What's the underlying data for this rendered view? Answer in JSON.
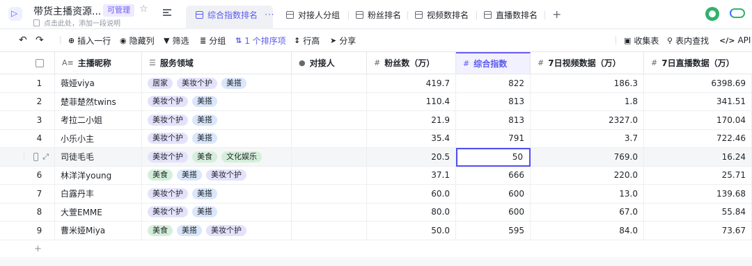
{
  "header": {
    "title": "带货主播资源...",
    "permission_badge": "可管理",
    "subtitle": "点击此处，添加一段说明",
    "tabs": [
      {
        "label": "综合指数排名",
        "more": "···"
      },
      {
        "label": "对接人分组"
      },
      {
        "label": "粉丝排名"
      },
      {
        "label": "视频数排名"
      },
      {
        "label": "直播数排名"
      }
    ],
    "add_tab": "+",
    "icons": {
      "logo": "base-logo-icon",
      "star": "star-icon",
      "menu": "menu-icon",
      "avatar": "avatar",
      "sync": "cloud-sync-icon"
    }
  },
  "toolbar": {
    "undo": "↶",
    "redo": "↷",
    "insert_row": "插入一行",
    "hide_columns": "隐藏列",
    "filter": "筛选",
    "group": "分组",
    "sort": "1 个排序项",
    "row_height": "行高",
    "share": "分享",
    "form": "收集表",
    "search": "表内查找",
    "api": "API",
    "accent_color": "#5b5bf0"
  },
  "table": {
    "columns": [
      {
        "label": "主播昵称",
        "icon": "text-field-icon"
      },
      {
        "label": "服务领域",
        "icon": "multi-select-icon"
      },
      {
        "label": "对接人",
        "icon": "person-icon"
      },
      {
        "label": "粉丝数（万）",
        "icon": "number-icon"
      },
      {
        "label": "综合指数",
        "icon": "number-icon"
      },
      {
        "label": "7日视频数据（万）",
        "icon": "number-icon"
      },
      {
        "label": "7日直播数据（万）",
        "icon": "number-icon"
      }
    ],
    "rows": [
      {
        "idx": "1",
        "name": "薇娅viya",
        "tags": [
          "居家",
          "美妆个护",
          "美搭"
        ],
        "contact": "",
        "fans": "419.7",
        "index": "822",
        "video": "186.3",
        "live": "6398.69"
      },
      {
        "idx": "2",
        "name": "楚菲楚然twins",
        "tags": [
          "美妆个护",
          "美搭"
        ],
        "contact": "",
        "fans": "110.4",
        "index": "813",
        "video": "1.8",
        "live": "341.51"
      },
      {
        "idx": "3",
        "name": "考拉二小姐",
        "tags": [
          "美妆个护",
          "美搭"
        ],
        "contact": "",
        "fans": "21.9",
        "index": "813",
        "video": "2327.0",
        "live": "170.04"
      },
      {
        "idx": "4",
        "name": "小乐小主",
        "tags": [
          "美妆个护",
          "美搭"
        ],
        "contact": "",
        "fans": "35.4",
        "index": "791",
        "video": "3.7",
        "live": "722.46"
      },
      {
        "idx": "",
        "name": "司徒毛毛",
        "tags": [
          "美妆个护",
          "美食",
          "文化娱乐"
        ],
        "contact": "",
        "fans": "20.5",
        "index": "50",
        "video": "769.0",
        "live": "16.24"
      },
      {
        "idx": "6",
        "name": "林洋洋young",
        "tags": [
          "美食",
          "美搭",
          "美妆个护"
        ],
        "contact": "",
        "fans": "37.1",
        "index": "666",
        "video": "220.0",
        "live": "25.71"
      },
      {
        "idx": "7",
        "name": "白露丹丰",
        "tags": [
          "美妆个护",
          "美搭"
        ],
        "contact": "",
        "fans": "60.0",
        "index": "600",
        "video": "13.0",
        "live": "139.68"
      },
      {
        "idx": "8",
        "name": "大萱EMME",
        "tags": [
          "美妆个护",
          "美搭"
        ],
        "contact": "",
        "fans": "80.0",
        "index": "600",
        "video": "67.0",
        "live": "55.84"
      },
      {
        "idx": "9",
        "name": "曹米娅Miya",
        "tags": [
          "美食",
          "美搭",
          "美妆个护"
        ],
        "contact": "",
        "fans": "50.0",
        "index": "595",
        "video": "84.0",
        "live": "73.67"
      }
    ],
    "tag_colors": {
      "居家": "purple",
      "美妆个护": "purple",
      "美搭": "blue",
      "美食": "green",
      "文化娱乐": "green"
    },
    "add_row": "+"
  }
}
